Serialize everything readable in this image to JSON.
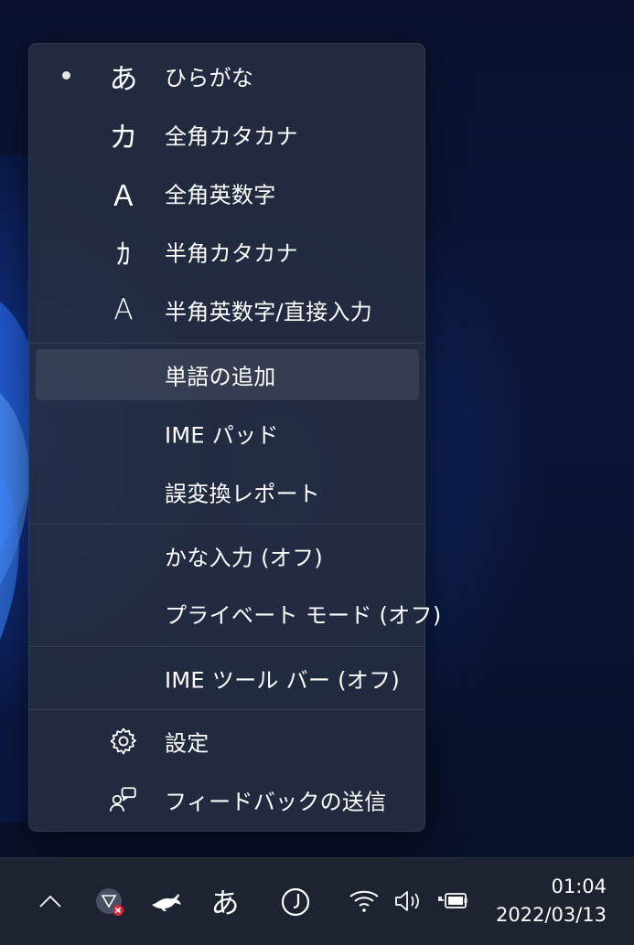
{
  "ime_menu": {
    "input_modes": [
      {
        "glyph": "あ",
        "label": "ひらがな",
        "selected": true
      },
      {
        "glyph": "カ",
        "label": "全角カタカナ",
        "selected": false
      },
      {
        "glyph": "Ａ",
        "label": "全角英数字",
        "selected": false
      },
      {
        "glyph": "ｶ",
        "label": "半角カタカナ",
        "selected": false
      },
      {
        "glyph": "A",
        "label": "半角英数字/直接入力",
        "selected": false
      }
    ],
    "tools": [
      {
        "label": "単語の追加"
      },
      {
        "label": "IME パッド"
      },
      {
        "label": "誤変換レポート"
      }
    ],
    "toggles": [
      {
        "label": "かな入力 (オフ)"
      },
      {
        "label": "プライベート モード (オフ)"
      }
    ],
    "toolbar_toggle": {
      "label": "IME ツール バー (オフ)"
    },
    "footer": [
      {
        "icon": "gear-icon",
        "label": "設定"
      },
      {
        "icon": "feedback-icon",
        "label": "フィードバックの送信"
      }
    ]
  },
  "taskbar": {
    "ime_indicator": "あ",
    "time": "01:04",
    "date": "2022/03/13"
  },
  "colors": {
    "menu_bg": "#242c40",
    "hover_bg": "#363d50",
    "taskbar_bg": "#1d2330"
  }
}
